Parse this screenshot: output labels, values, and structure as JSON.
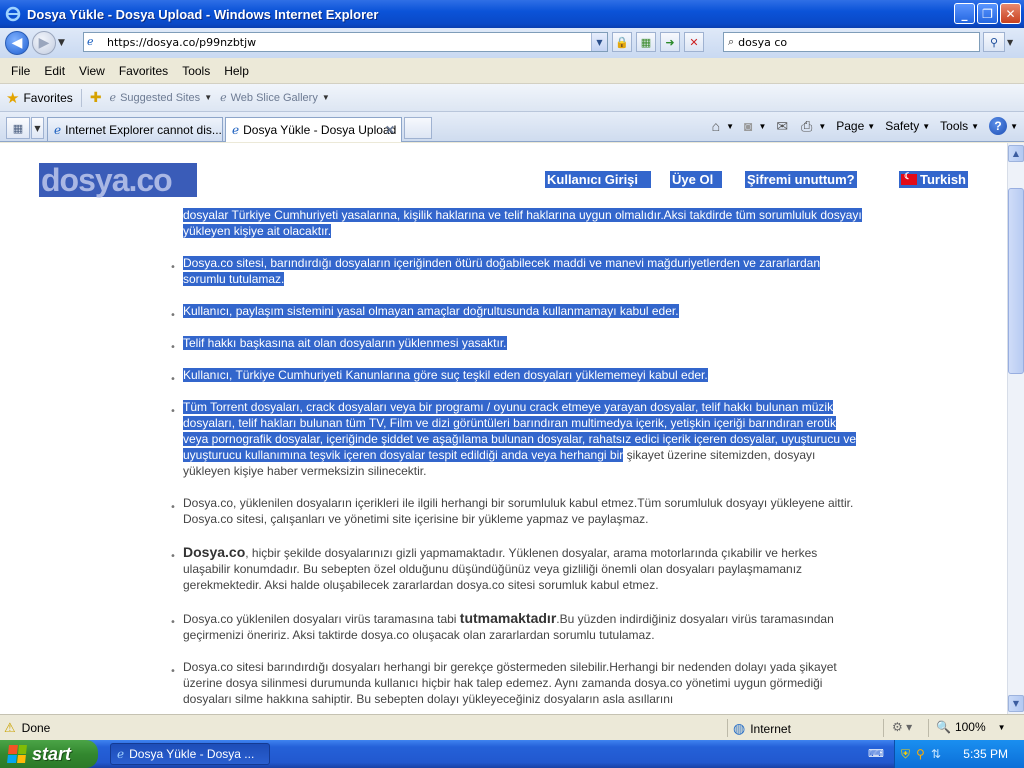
{
  "window": {
    "title": "Dosya Yükle - Dosya Upload - Windows Internet Explorer",
    "controls": [
      "_",
      "❐",
      "✕"
    ]
  },
  "address": {
    "url": "https://dosya.co/p99nzbtjw"
  },
  "search": {
    "value": "dosya co"
  },
  "menu": [
    "File",
    "Edit",
    "View",
    "Favorites",
    "Tools",
    "Help"
  ],
  "favorites": {
    "label": "Favorites",
    "links": [
      "Suggested Sites",
      "Web Slice Gallery"
    ]
  },
  "tabs": [
    {
      "label": "Internet Explorer cannot dis...",
      "active": false
    },
    {
      "label": "Dosya Yükle - Dosya Upload",
      "active": true
    }
  ],
  "commands": [
    "Page",
    "Safety",
    "Tools"
  ],
  "site": {
    "logo": "dosya.co",
    "nav": [
      "Kullanıcı Girişi",
      "Üye Ol",
      "Şifremi unuttum?",
      "Turkish"
    ]
  },
  "paragraphs": [
    {
      "text": "dosyalar Türkiye Cumhuriyeti yasalarına, kişilik haklarına ve telif haklarına uygun olmalıdır.Aksi takdirde tüm sorumluluk dosyayı yükleyen kişiye ait olacaktır."
    },
    {
      "text": "Dosya.co sitesi, barındırdığı dosyaların içeriğinden ötürü doğabilecek maddi ve manevi mağduriyetlerden ve zararlardan sorumlu tutulamaz."
    },
    {
      "text": "Kullanıcı, paylaşım sistemini yasal olmayan amaçlar doğrultusunda kullanmamayı kabul eder."
    },
    {
      "text": "Telif hakkı başkasına ait olan dosyaların yüklenmesi yasaktır."
    },
    {
      "text": "Kullanıcı, Türkiye Cumhuriyeti Kanunlarına göre suç teşkil eden dosyaları yüklememeyi kabul eder."
    },
    {
      "text_selected": "Tüm Torrent dosyaları, crack dosyaları veya bir programı / oyunu crack etmeye yarayan dosyalar, telif hakkı bulunan müzik dosyaları, telif hakları bulunan tüm TV, Film ve dizi görüntüleri barındıran multimedya içerik, yetişkin içeriği barındıran erotik veya pornografik dosyalar, içeriğinde şiddet ve aşağılama bulunan dosyalar, rahatsız edici içerik içeren dosyalar, uyuşturucu ve uyuşturucu kullanımına teşvik içeren dosyalar tespit edildiği anda veya herhangi bir",
      "text_rest": "şikayet üzerine sitemizden, dosyayı yükleyen kişiye haber vermeksizin silinecektir."
    },
    {
      "text": "Dosya.co, yüklenilen dosyaların içerikleri ile ilgili herhangi bir sorumluluk kabul etmez.Tüm sorumluluk dosyayı yükleyene aittir. Dosya.co sitesi, çalışanları ve yönetimi site içerisine bir yükleme yapmaz ve paylaşmaz."
    },
    {
      "bold": "Dosya.co",
      "text": ", hiçbir şekilde dosyalarınızı gizli yapmamaktadır. Yüklenen dosyalar, arama motorlarında çıkabilir ve herkes ulaşabilir konumdadır. Bu sebepten özel olduğunu düşündüğünüz veya gizliliği önemli olan dosyaları paylaşmamanız gerekmektedir. Aksi halde oluşabilecek zararlardan dosya.co sitesi sorumluk kabul etmez."
    },
    {
      "text_a": "Dosya.co yüklenilen dosyaları virüs taramasına tabi ",
      "bold": "tutmamaktadır",
      "text_b": ".Bu yüzden indirdiğiniz dosyaları virüs taramasından geçirmenizi öneririz. Aksi taktirde dosya.co oluşacak olan zararlardan sorumlu tutulamaz."
    },
    {
      "text": "Dosya.co sitesi barındırdığı dosyaları herhangi bir gerekçe göstermeden silebilir.Herhangi bir nedenden dolayı yada şikayet üzerine dosya silinmesi durumunda kullanıcı hiçbir hak talep edemez. Aynı zamanda dosya.co yönetimi uygun görmediği dosyaları silme hakkına sahiptir. Bu sebepten dolayı yükleyeceğiniz dosyaların asla asıllarını"
    }
  ],
  "status": {
    "text": "Done",
    "zone": "Internet",
    "zoom": "100%"
  },
  "taskbar": {
    "start": "start",
    "item": "Dosya Yükle - Dosya ...",
    "clock": "5:35 PM"
  }
}
